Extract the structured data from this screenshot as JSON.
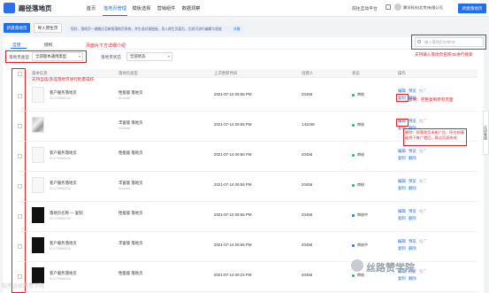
{
  "header": {
    "logo_text": "踢径落地页",
    "nav": [
      "首页",
      "落地页管理",
      "模板选择",
      "营销组件",
      "数据洞察"
    ],
    "nav_active": 1,
    "platform_link": "前往互动平台",
    "company": "腾讯科技(北京)有限公司",
    "create_button": "新建落地页"
  },
  "toolbar": {
    "create_button": "新建落地页",
    "import_button": "导入原生页",
    "notice": "您好，落地页一键搬迁至新版落地页系统，并生成对接链接，导入原生页面后，后续可进行编辑与投放",
    "notice_link": "详情"
  },
  "tabs": [
    "自建",
    "授权"
  ],
  "filters": {
    "type_label": "落地页类型",
    "type_value": "全部版本通用类型",
    "status_label": "落地页状态",
    "status_value": "全部状态",
    "search_placeholder": "输入落地页名称/ID"
  },
  "annotations": {
    "below_table": "页面片下方详细介绍",
    "search_note": "支持输入落地页名称/ID进行搜索",
    "select_note": "支持全选/多选落地页进行批量操作",
    "copy_note": "复制：完整复制原有页面",
    "delete_note": "删除：前落地页未新广告、所在的基础到下推广就后，再过页面失效"
  },
  "table": {
    "columns": [
      "基本信息",
      "落地页类型",
      "上次更新时间",
      "创建人",
      "状态",
      "操作"
    ],
    "rows": [
      {
        "name": "客户服务落地页",
        "id": "ID:170988234",
        "type": "性能版 落地页",
        "type_sub": "Android",
        "time": "2021-07-14 09:56 PM",
        "creator": "20456",
        "status": "审核",
        "ops": [
          "编辑",
          "预览",
          "推广",
          "复制",
          "删除"
        ],
        "thumb": "light"
      },
      {
        "name": "",
        "id": "",
        "type": "丰富版 落地页",
        "type_sub": "Android",
        "time": "2021-07-14 09:56 PM",
        "creator": "141048",
        "status": "审核",
        "ops": [
          "编辑",
          "预览",
          "推广",
          "复制",
          "删除"
        ],
        "thumb": "photo"
      },
      {
        "name": "客户服务落地页",
        "id": "ID:170988234",
        "type": "性能版 落地页",
        "type_sub": "",
        "time": "2021-07-14 09:56 PM",
        "creator": "20456",
        "status": "审核",
        "ops": [
          "编辑",
          "预览",
          "推广",
          "复制",
          "删除"
        ],
        "thumb": "light"
      },
      {
        "name": "客户服务落地页",
        "id": "ID:170988234",
        "type": "丰富版 落地页",
        "type_sub": "Android",
        "time": "2021-07-14 09:56 PM",
        "creator": "20456",
        "status": "审核",
        "ops": [
          "编辑",
          "预览",
          "推广",
          "复制",
          "删除"
        ],
        "thumb": "light"
      },
      {
        "name": "落地页名称 — 复制",
        "id": "ID:170988234",
        "type": "性能版 落地页",
        "type_sub": "",
        "time": "2021-07-14 09:56 PM",
        "creator": "20456",
        "status": "审核中",
        "ops": [
          "编辑",
          "预览",
          "推广",
          "复制",
          "删除"
        ],
        "thumb": "dark"
      },
      {
        "name": "客户服务落地页",
        "id": "ID:170988234",
        "type": "丰富版 落地页",
        "type_sub": "",
        "time": "2021-07-14 09:56 PM",
        "creator": "20456",
        "status": "审核中",
        "ops": [
          "编辑",
          "预览",
          "推广",
          "复制",
          "删除"
        ],
        "thumb": "dark"
      },
      {
        "name": "客户服务落地页",
        "id": "ID:170988234",
        "type": "性能版 落地页",
        "type_sub": "",
        "time": "2021-07-14 09:24 PM",
        "creator": "20456",
        "status": "审核",
        "ops": [
          "编辑",
          "预览",
          "推广",
          "复制",
          "删除"
        ],
        "thumb": "dark"
      }
    ]
  },
  "side_tab": "在线客服",
  "watermark": "丝路赞学院",
  "watermark_corner": "知乎@丝路赞学院",
  "colors": {
    "accent": "#1f6fe8",
    "annotation": "#e0232b",
    "status_ok": "#2fae62"
  }
}
